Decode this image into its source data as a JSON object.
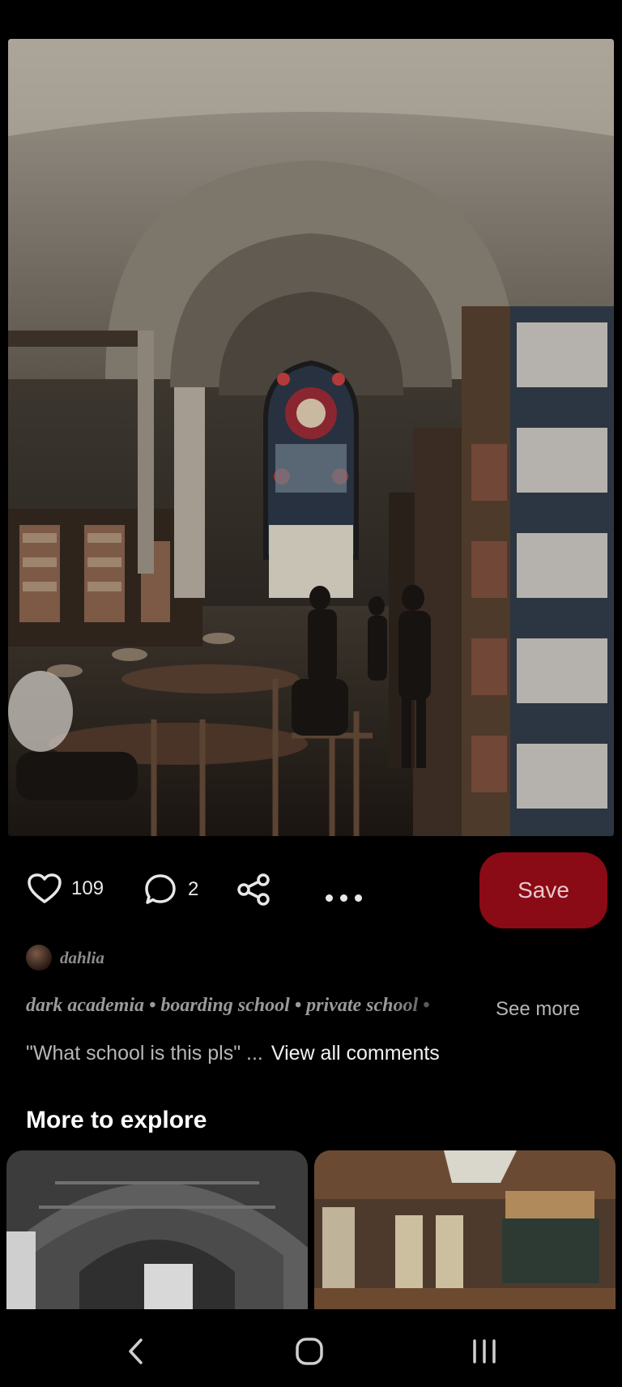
{
  "pin": {
    "image_alt": "Library reading room with vaulted ceiling and stained glass window",
    "likes": "109",
    "comments": "2",
    "save_label": "Save"
  },
  "author": {
    "name": "dahlia"
  },
  "tags": [
    "dark academia",
    "boarding school",
    "private school"
  ],
  "tag_separator": "•",
  "see_more_label": "See more",
  "comment_preview": {
    "text": "\"What school is this pls\" ...",
    "view_all_label": "View all comments"
  },
  "explore": {
    "title": "More to explore"
  },
  "icons": {
    "like": "heart-icon",
    "comment": "comment-icon",
    "share": "share-icon",
    "more": "more-options-icon",
    "nav_back": "back-icon",
    "nav_home": "home-icon",
    "nav_recents": "recents-icon"
  },
  "colors": {
    "save_button": "#8a0a15",
    "background": "#000000"
  }
}
